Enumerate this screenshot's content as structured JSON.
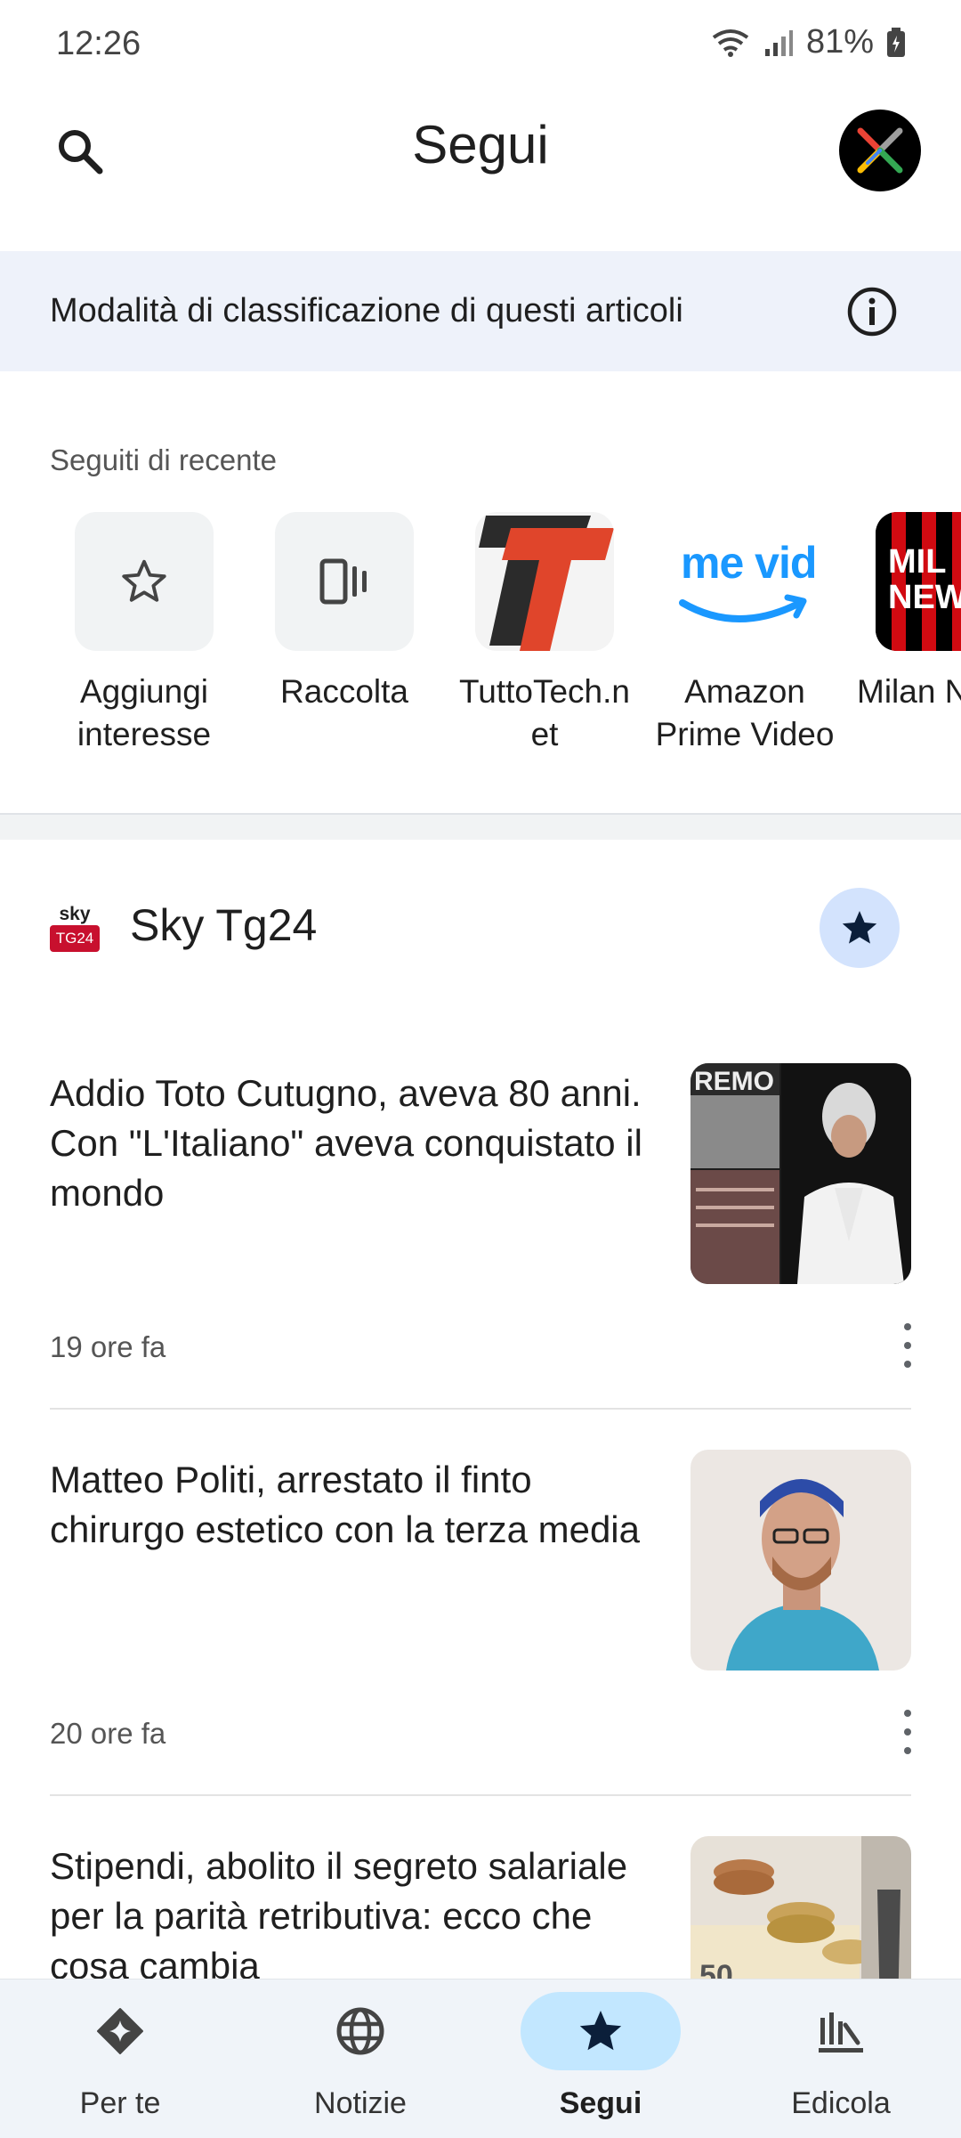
{
  "status_bar": {
    "time": "12:26",
    "battery": "81%"
  },
  "header": {
    "title": "Segui"
  },
  "banner": {
    "text": "Modalità di classificazione di questi articoli"
  },
  "recent": {
    "heading": "Seguiti di recente",
    "items": [
      {
        "label": "Aggiungi\ninteresse",
        "icon": "star-outline-icon"
      },
      {
        "label": "Raccolta",
        "icon": "collection-icon"
      },
      {
        "label": "TuttoTech.n\net",
        "icon": "tuttotech-logo"
      },
      {
        "label": "Amazon\nPrime Video",
        "icon": "prime-video-logo",
        "logo_text": "me vid"
      },
      {
        "label": "Milan N",
        "icon": "milan-news-logo",
        "logo_text_1": "MIL",
        "logo_text_2": "NEW"
      }
    ]
  },
  "source": {
    "name": "Sky Tg24",
    "logo_line1": "sky",
    "logo_line2": "TG24"
  },
  "articles": [
    {
      "title": "Addio Toto Cutugno, aveva 80 anni. Con \"L'Italiano\" aveva conquistato il mondo",
      "time": "19 ore fa"
    },
    {
      "title": "Matteo Politi, arrestato il finto chirurgo estetico con la terza media",
      "time": "20 ore fa"
    },
    {
      "title": "Stipendi, abolito il segreto salariale per la parità retributiva: ecco che cosa cambia"
    }
  ],
  "bottom_nav": [
    {
      "label": "Per te",
      "icon": "for-you-icon"
    },
    {
      "label": "Notizie",
      "icon": "globe-icon"
    },
    {
      "label": "Segui",
      "icon": "star-icon",
      "active": true
    },
    {
      "label": "Edicola",
      "icon": "newsstand-icon"
    }
  ],
  "colors": {
    "accent": "#c2e7ff",
    "banner": "#eef2fa",
    "nav_bg": "#f0f4f9",
    "follow_btn": "#d3e3fd"
  }
}
